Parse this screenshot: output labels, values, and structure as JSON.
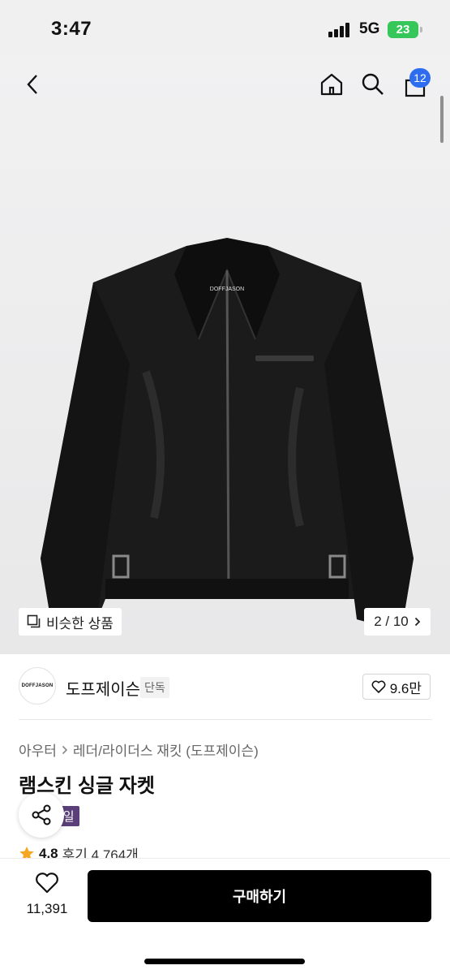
{
  "status": {
    "time": "3:47",
    "network": "5G",
    "battery": "23"
  },
  "header": {
    "cart_count": "12",
    "icons": [
      "back-icon",
      "home-icon",
      "search-icon",
      "cart-icon"
    ]
  },
  "gallery": {
    "similar_label": "비슷한 상품",
    "pager": "2 / 10",
    "jacket_logo": "DOFFJASON"
  },
  "brand": {
    "logo_text": "DOFFJASON",
    "name": "도프제이슨",
    "tag": "단독",
    "likes": "9.6만"
  },
  "product": {
    "breadcrumb": [
      "아우터",
      "레더/라이더스 재킷 (도프제이슨)"
    ],
    "title": "램스킨 싱글 자켓",
    "sale_badge": "세일",
    "rating": "4.8",
    "reviews": "후기 4,764개"
  },
  "bottom": {
    "wish_count": "11,391",
    "buy_label": "구매하기"
  },
  "colors": {
    "accent": "#2f6df0",
    "sale": "#5a3f78",
    "battery": "#35c759",
    "star": "#f5a623"
  }
}
